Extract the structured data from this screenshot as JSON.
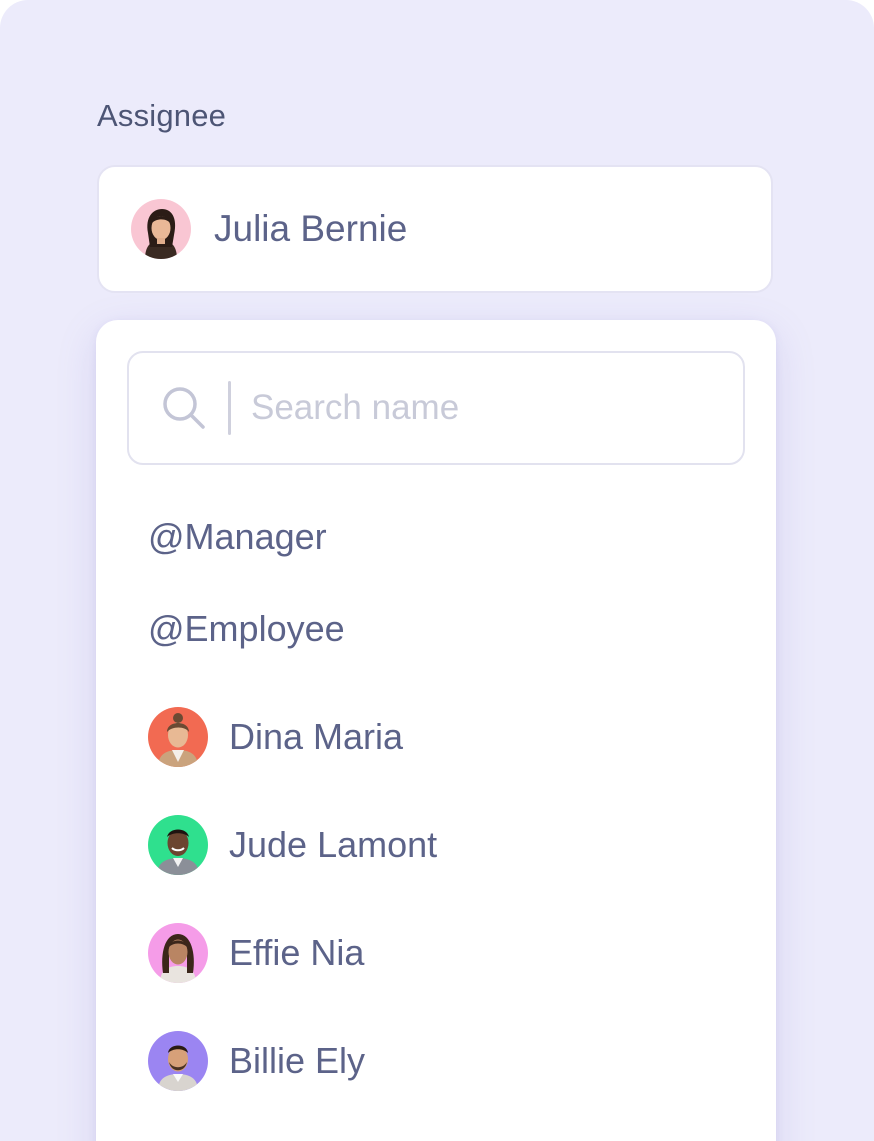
{
  "field": {
    "label": "Assignee",
    "selected": {
      "name": "Julia Bernie",
      "avatar_bg": "#f9c6d3"
    }
  },
  "search": {
    "placeholder": "Search name",
    "value": ""
  },
  "roles": [
    {
      "label": "@Manager"
    },
    {
      "label": "@Employee"
    }
  ],
  "people": [
    {
      "name": "Dina Maria",
      "avatar_bg": "#f26a52"
    },
    {
      "name": "Jude Lamont",
      "avatar_bg": "#2fe08e"
    },
    {
      "name": "Effie Nia",
      "avatar_bg": "#f59ce8"
    },
    {
      "name": "Billie Ely",
      "avatar_bg": "#9b85f2"
    }
  ],
  "colors": {
    "background": "#ecebfb",
    "text": "#5c6389",
    "placeholder": "#c8cad8",
    "border": "#e2e2ef"
  },
  "icons": {
    "search": "search-icon"
  }
}
